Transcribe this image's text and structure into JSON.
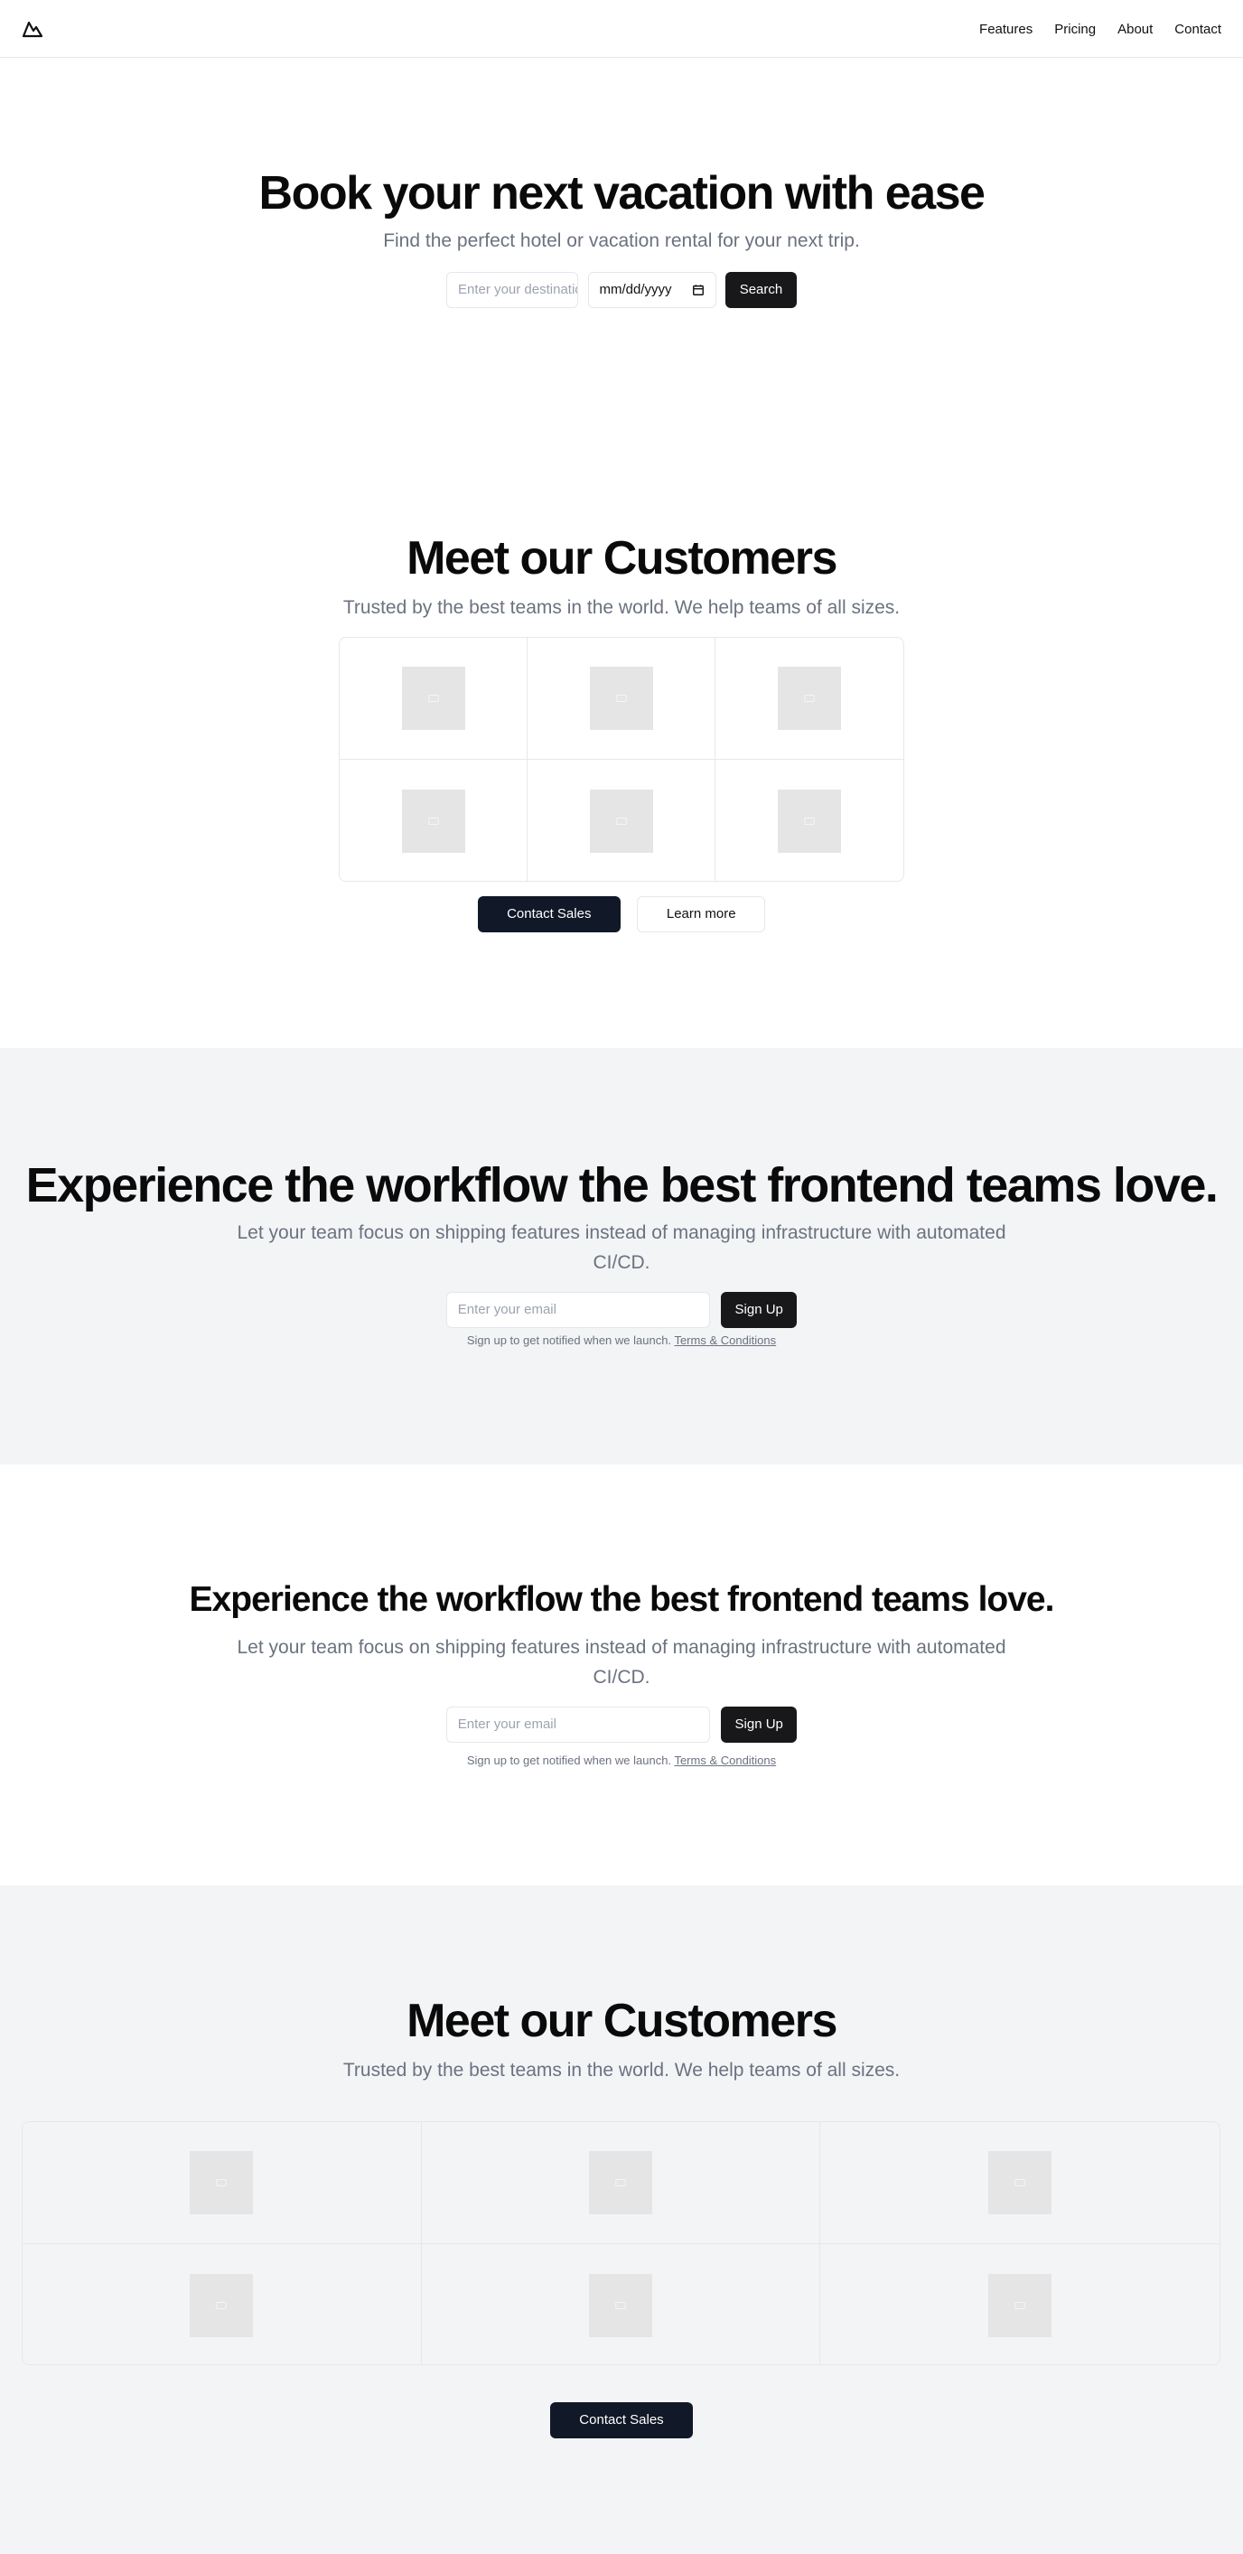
{
  "header": {
    "logo_icon": "mountain-icon",
    "nav": [
      "Features",
      "Pricing",
      "About",
      "Contact"
    ]
  },
  "hero": {
    "title": "Book your next vacation with ease",
    "subtitle": "Find the perfect hotel or vacation rental for your next trip.",
    "destination_placeholder": "Enter your destination",
    "date_value": "mm/dd/yyyy",
    "search_label": "Search"
  },
  "customers1": {
    "title": "Meet our Customers",
    "subtitle": "Trusted by the best teams in the world. We help teams of all sizes.",
    "logo_icon": "image-placeholder-icon",
    "contact_label": "Contact Sales",
    "learn_label": "Learn more"
  },
  "workflow1": {
    "title": "Experience the workflow the best frontend teams love.",
    "subtitle": "Let your team focus on shipping features instead of managing infrastructure with automated CI/CD.",
    "email_placeholder": "Enter your email",
    "signup_label": "Sign Up",
    "fine_text": "Sign up to get notified when we launch.",
    "terms_label": "Terms & Conditions"
  },
  "workflow2": {
    "title": "Experience the workflow the best frontend teams love.",
    "subtitle": "Let your team focus on shipping features instead of managing infrastructure with automated CI/CD.",
    "email_placeholder": "Enter your email",
    "signup_label": "Sign Up",
    "fine_text": "Sign up to get notified when we launch.",
    "terms_label": "Terms & Conditions"
  },
  "customers2": {
    "title": "Meet our Customers",
    "subtitle": "Trusted by the best teams in the world. We help teams of all sizes.",
    "contact_label": "Contact Sales"
  },
  "colors": {
    "dark_button": "#18181b",
    "navy_button": "#111827",
    "muted_section": "#f3f4f6",
    "placeholder_box": "#e5e5e5"
  }
}
